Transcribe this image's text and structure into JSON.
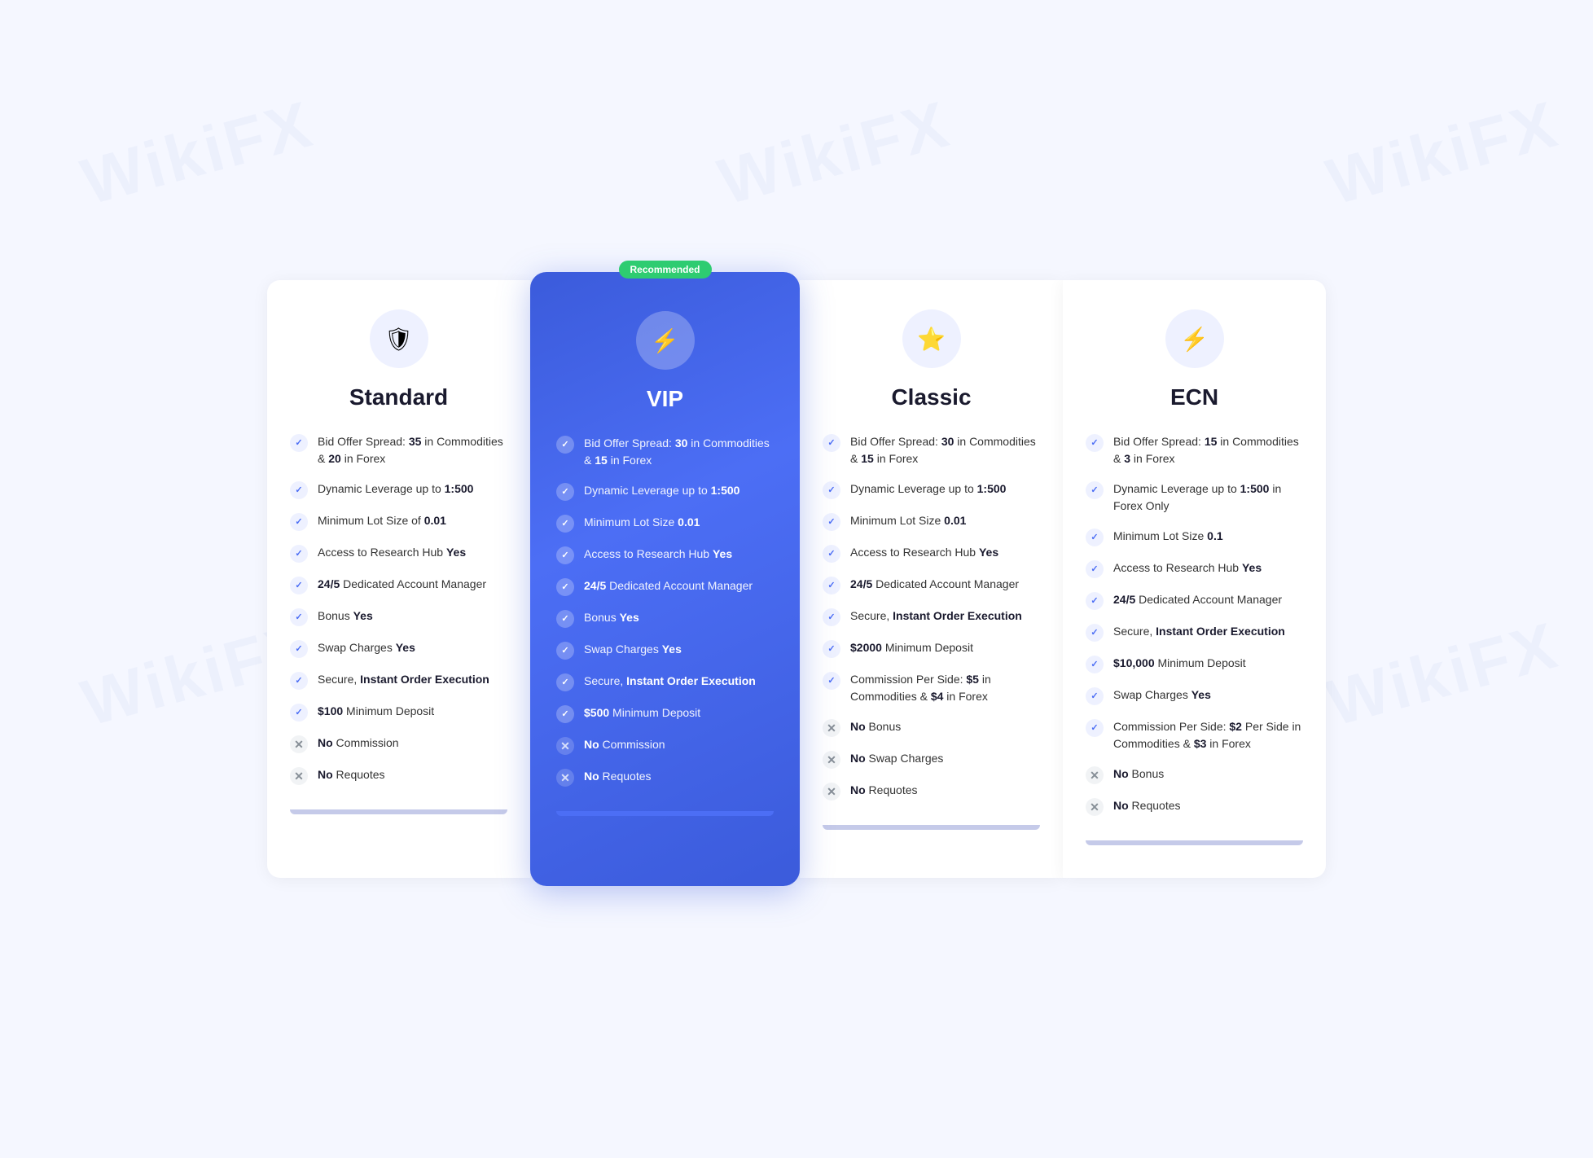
{
  "watermark": "WikiFX",
  "recommended_label": "Recommended",
  "plans": [
    {
      "id": "standard",
      "name": "Standard",
      "icon": "🛡",
      "is_vip": false,
      "is_recommended": false,
      "features": [
        {
          "check": true,
          "text": "Bid Offer Spread: <b>35</b> in Commodities & <b>20</b> in Forex"
        },
        {
          "check": true,
          "text": "Dynamic Leverage up to <b>1:500</b>"
        },
        {
          "check": true,
          "text": "Minimum Lot Size of <b>0.01</b>"
        },
        {
          "check": true,
          "text": "Access to Research Hub <b>Yes</b>"
        },
        {
          "check": true,
          "text": "<b>24/5</b> Dedicated Account Manager"
        },
        {
          "check": true,
          "text": "Bonus <b>Yes</b>"
        },
        {
          "check": true,
          "text": "Swap Charges <b>Yes</b>"
        },
        {
          "check": true,
          "text": "Secure, <b>Instant Order Execution</b>"
        },
        {
          "check": true,
          "text": "<b>$100</b> Minimum Deposit"
        },
        {
          "check": false,
          "text": "<b>No</b> Commission"
        },
        {
          "check": false,
          "text": "<b>No</b> Requotes"
        }
      ]
    },
    {
      "id": "vip",
      "name": "VIP",
      "icon": "⚡",
      "is_vip": true,
      "is_recommended": true,
      "features": [
        {
          "check": true,
          "text": "Bid Offer Spread: <b>30</b> in Commodities & <b>15</b> in Forex"
        },
        {
          "check": true,
          "text": "Dynamic Leverage up to <b>1:500</b>"
        },
        {
          "check": true,
          "text": "Minimum Lot Size <b>0.01</b>"
        },
        {
          "check": true,
          "text": "Access to Research Hub <b>Yes</b>"
        },
        {
          "check": true,
          "text": "<b>24/5</b> Dedicated Account Manager"
        },
        {
          "check": true,
          "text": "Bonus <b>Yes</b>"
        },
        {
          "check": true,
          "text": "Swap Charges <b>Yes</b>"
        },
        {
          "check": true,
          "text": "Secure, <b>Instant Order Execution</b>"
        },
        {
          "check": true,
          "text": "<b>$500</b> Minimum Deposit"
        },
        {
          "check": false,
          "text": "<b>No</b> Commission"
        },
        {
          "check": false,
          "text": "<b>No</b> Requotes"
        }
      ]
    },
    {
      "id": "classic",
      "name": "Classic",
      "icon": "⭐",
      "is_vip": false,
      "is_recommended": false,
      "features": [
        {
          "check": true,
          "text": "Bid Offer Spread: <b>30</b> in Commodities & <b>15</b> in Forex"
        },
        {
          "check": true,
          "text": "Dynamic Leverage up to <b>1:500</b>"
        },
        {
          "check": true,
          "text": "Minimum Lot Size <b>0.01</b>"
        },
        {
          "check": true,
          "text": "Access to Research Hub <b>Yes</b>"
        },
        {
          "check": true,
          "text": "<b>24/5</b> Dedicated Account Manager"
        },
        {
          "check": true,
          "text": "Secure, <b>Instant Order Execution</b>"
        },
        {
          "check": true,
          "text": "<b>$2000</b> Minimum Deposit"
        },
        {
          "check": true,
          "text": "Commission Per Side: <b>$5</b> in Commodities & <b>$4</b> in Forex"
        },
        {
          "check": false,
          "text": "<b>No</b> Bonus"
        },
        {
          "check": false,
          "text": "<b>No</b> Swap Charges"
        },
        {
          "check": false,
          "text": "<b>No</b> Requotes"
        }
      ]
    },
    {
      "id": "ecn",
      "name": "ECN",
      "icon": "⚡",
      "is_vip": false,
      "is_recommended": false,
      "features": [
        {
          "check": true,
          "text": "Bid Offer Spread: <b>15</b> in Commodities & <b>3</b> in Forex"
        },
        {
          "check": true,
          "text": "Dynamic Leverage up to <b>1:500</b> in Forex Only"
        },
        {
          "check": true,
          "text": "Minimum Lot Size <b>0.1</b>"
        },
        {
          "check": true,
          "text": "Access to Research Hub <b>Yes</b>"
        },
        {
          "check": true,
          "text": "<b>24/5</b> Dedicated Account Manager"
        },
        {
          "check": true,
          "text": "Secure, <b>Instant Order Execution</b>"
        },
        {
          "check": true,
          "text": "<b>$10,000</b> Minimum Deposit"
        },
        {
          "check": true,
          "text": "Swap Charges <b>Yes</b>"
        },
        {
          "check": true,
          "text": "Commission Per Side: <b>$2</b> Per Side in Commodities & <b>$3</b> in Forex"
        },
        {
          "check": false,
          "text": "<b>No</b> Bonus"
        },
        {
          "check": false,
          "text": "<b>No</b> Requotes"
        }
      ]
    }
  ]
}
